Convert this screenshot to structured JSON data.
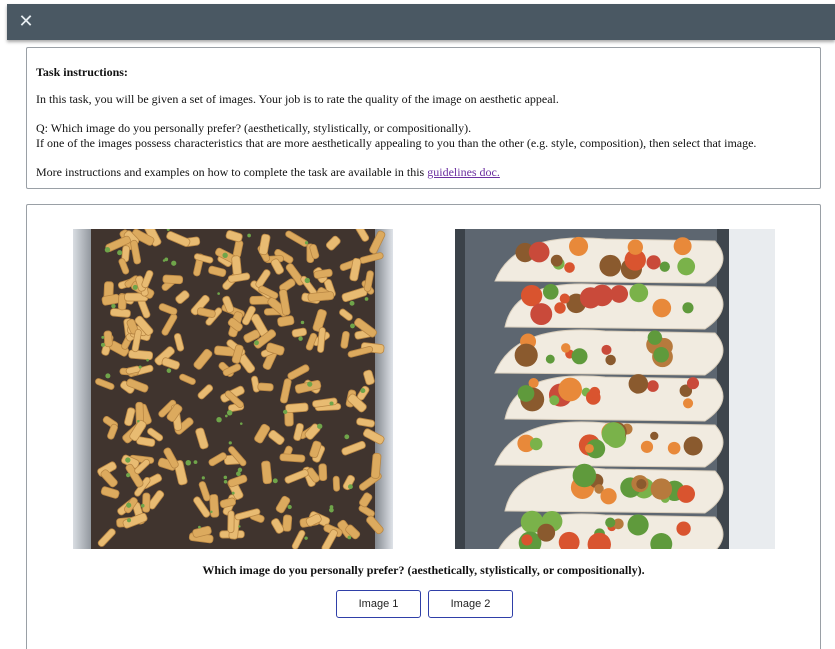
{
  "header": {
    "close_icon": "close-icon"
  },
  "instructions": {
    "title": "Task instructions:",
    "intro": "In this task, you will be given a set of images. Your job is to rate the quality of the image on aesthetic appeal.",
    "question_line": "Q: Which image do you personally prefer? (aesthetically, stylistically, or compositionally).",
    "detail_line": "If one of the images possess characteristics that are more aesthetically appealing to you than the other (e.g. style, composition), then select that image.",
    "more_prefix": "More instructions and examples on how to complete the task are available in this ",
    "link_text": "guidelines doc."
  },
  "task": {
    "question": "Which image do you personally prefer? (aesthetically, stylistically, or compositionally).",
    "button_1": "Image 1",
    "button_2": "Image 2"
  },
  "colors": {
    "topbar": "#4a5863",
    "button_border": "#2f3fa8",
    "link": "#6b2fa0"
  }
}
